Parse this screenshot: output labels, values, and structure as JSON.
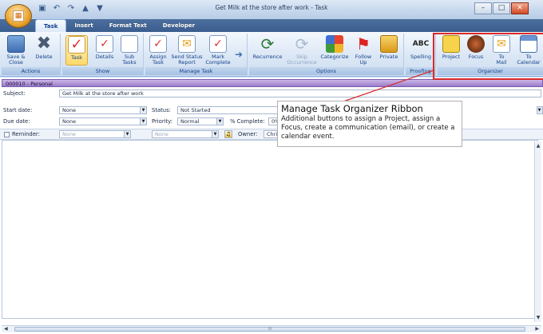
{
  "window": {
    "title": "Get Milk at the store after work - Task"
  },
  "tabs": [
    "Task",
    "Insert",
    "Format Text",
    "Developer"
  ],
  "ribbon": {
    "groups": {
      "actions": {
        "label": "Actions",
        "save_close": [
          "Save &",
          "Close"
        ],
        "delete": "Delete"
      },
      "show": {
        "label": "Show",
        "task": "Task",
        "details": "Details",
        "sub_tasks": [
          "Sub",
          "Tasks"
        ]
      },
      "manage": {
        "label": "Manage Task",
        "assign": [
          "Assign",
          "Task"
        ],
        "send_status": [
          "Send Status",
          "Report"
        ],
        "mark_complete": [
          "Mark",
          "Complete"
        ]
      },
      "options": {
        "label": "Options",
        "recurrence": "Recurrence",
        "skip": [
          "Skip",
          "Occurrence"
        ],
        "categorize": "Categorize",
        "follow_up": [
          "Follow",
          "Up"
        ],
        "private": "Private"
      },
      "proofing": {
        "label": "Proofing",
        "spelling": "Spelling",
        "abc": "ABC"
      },
      "organizer": {
        "label": "Organizer",
        "project": "Project",
        "focus": "Focus",
        "to_mail": [
          "To",
          "Mail"
        ],
        "to_calendar": [
          "To",
          "Calendar"
        ]
      }
    }
  },
  "form": {
    "infobar": "000010 - Personal",
    "subject_label": "Subject:",
    "subject_value": "Get Milk at the store after work",
    "start_label": "Start date:",
    "start_value": "None",
    "due_label": "Due date:",
    "due_value": "None",
    "status_label": "Status:",
    "status_value": "Not Started",
    "priority_label": "Priority:",
    "priority_value": "Normal",
    "complete_label": "% Complete:",
    "complete_value": "0%",
    "reminder_label": "Reminder:",
    "reminder_date": "None",
    "reminder_time": "None",
    "owner_label": "Owner:",
    "owner_value": "Chri",
    "hscroll_grip": "III"
  },
  "callout": {
    "title": "Manage Task Organizer Ribbon",
    "body": "Additional buttons to assign a Project, assign a Focus, create a communication (email), or create a calendar event."
  },
  "colors": {
    "accent_red": "#d92a2a",
    "ribbon_blue": "#15428b",
    "infobar_purple": "#9a7cc9"
  }
}
